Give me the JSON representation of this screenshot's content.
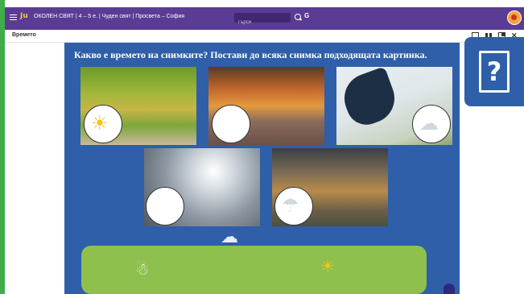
{
  "topbar": {
    "logo": "Ju",
    "title": "ОКОЛЕН СВЯТ | 4 – 5 е. | Чуден свят | Просвета – София",
    "search_placeholder": "Търси",
    "g_label": "G"
  },
  "subbar": {
    "section_title": "Времето"
  },
  "exercise": {
    "instruction": "Какво е времето на снимките? Постави до всяка снимка подходящата картинка.",
    "photos": [
      {
        "subject": "autumn-park",
        "answer": "sunny"
      },
      {
        "subject": "rainy-alley",
        "answer": ""
      },
      {
        "subject": "windy-umbrella",
        "answer": "cloudy-windy"
      },
      {
        "subject": "cloudy-sky",
        "answer": ""
      },
      {
        "subject": "rain-bench",
        "answer": "rainy"
      }
    ]
  },
  "tokens": [
    "cloudy-snow",
    "sun-with-cloud",
    "cloud"
  ],
  "colors": {
    "topbar": "#5a3c95",
    "content": "#2e5fa8",
    "drop_zone": "#8ec04e",
    "frame_border": "#41ad49"
  }
}
